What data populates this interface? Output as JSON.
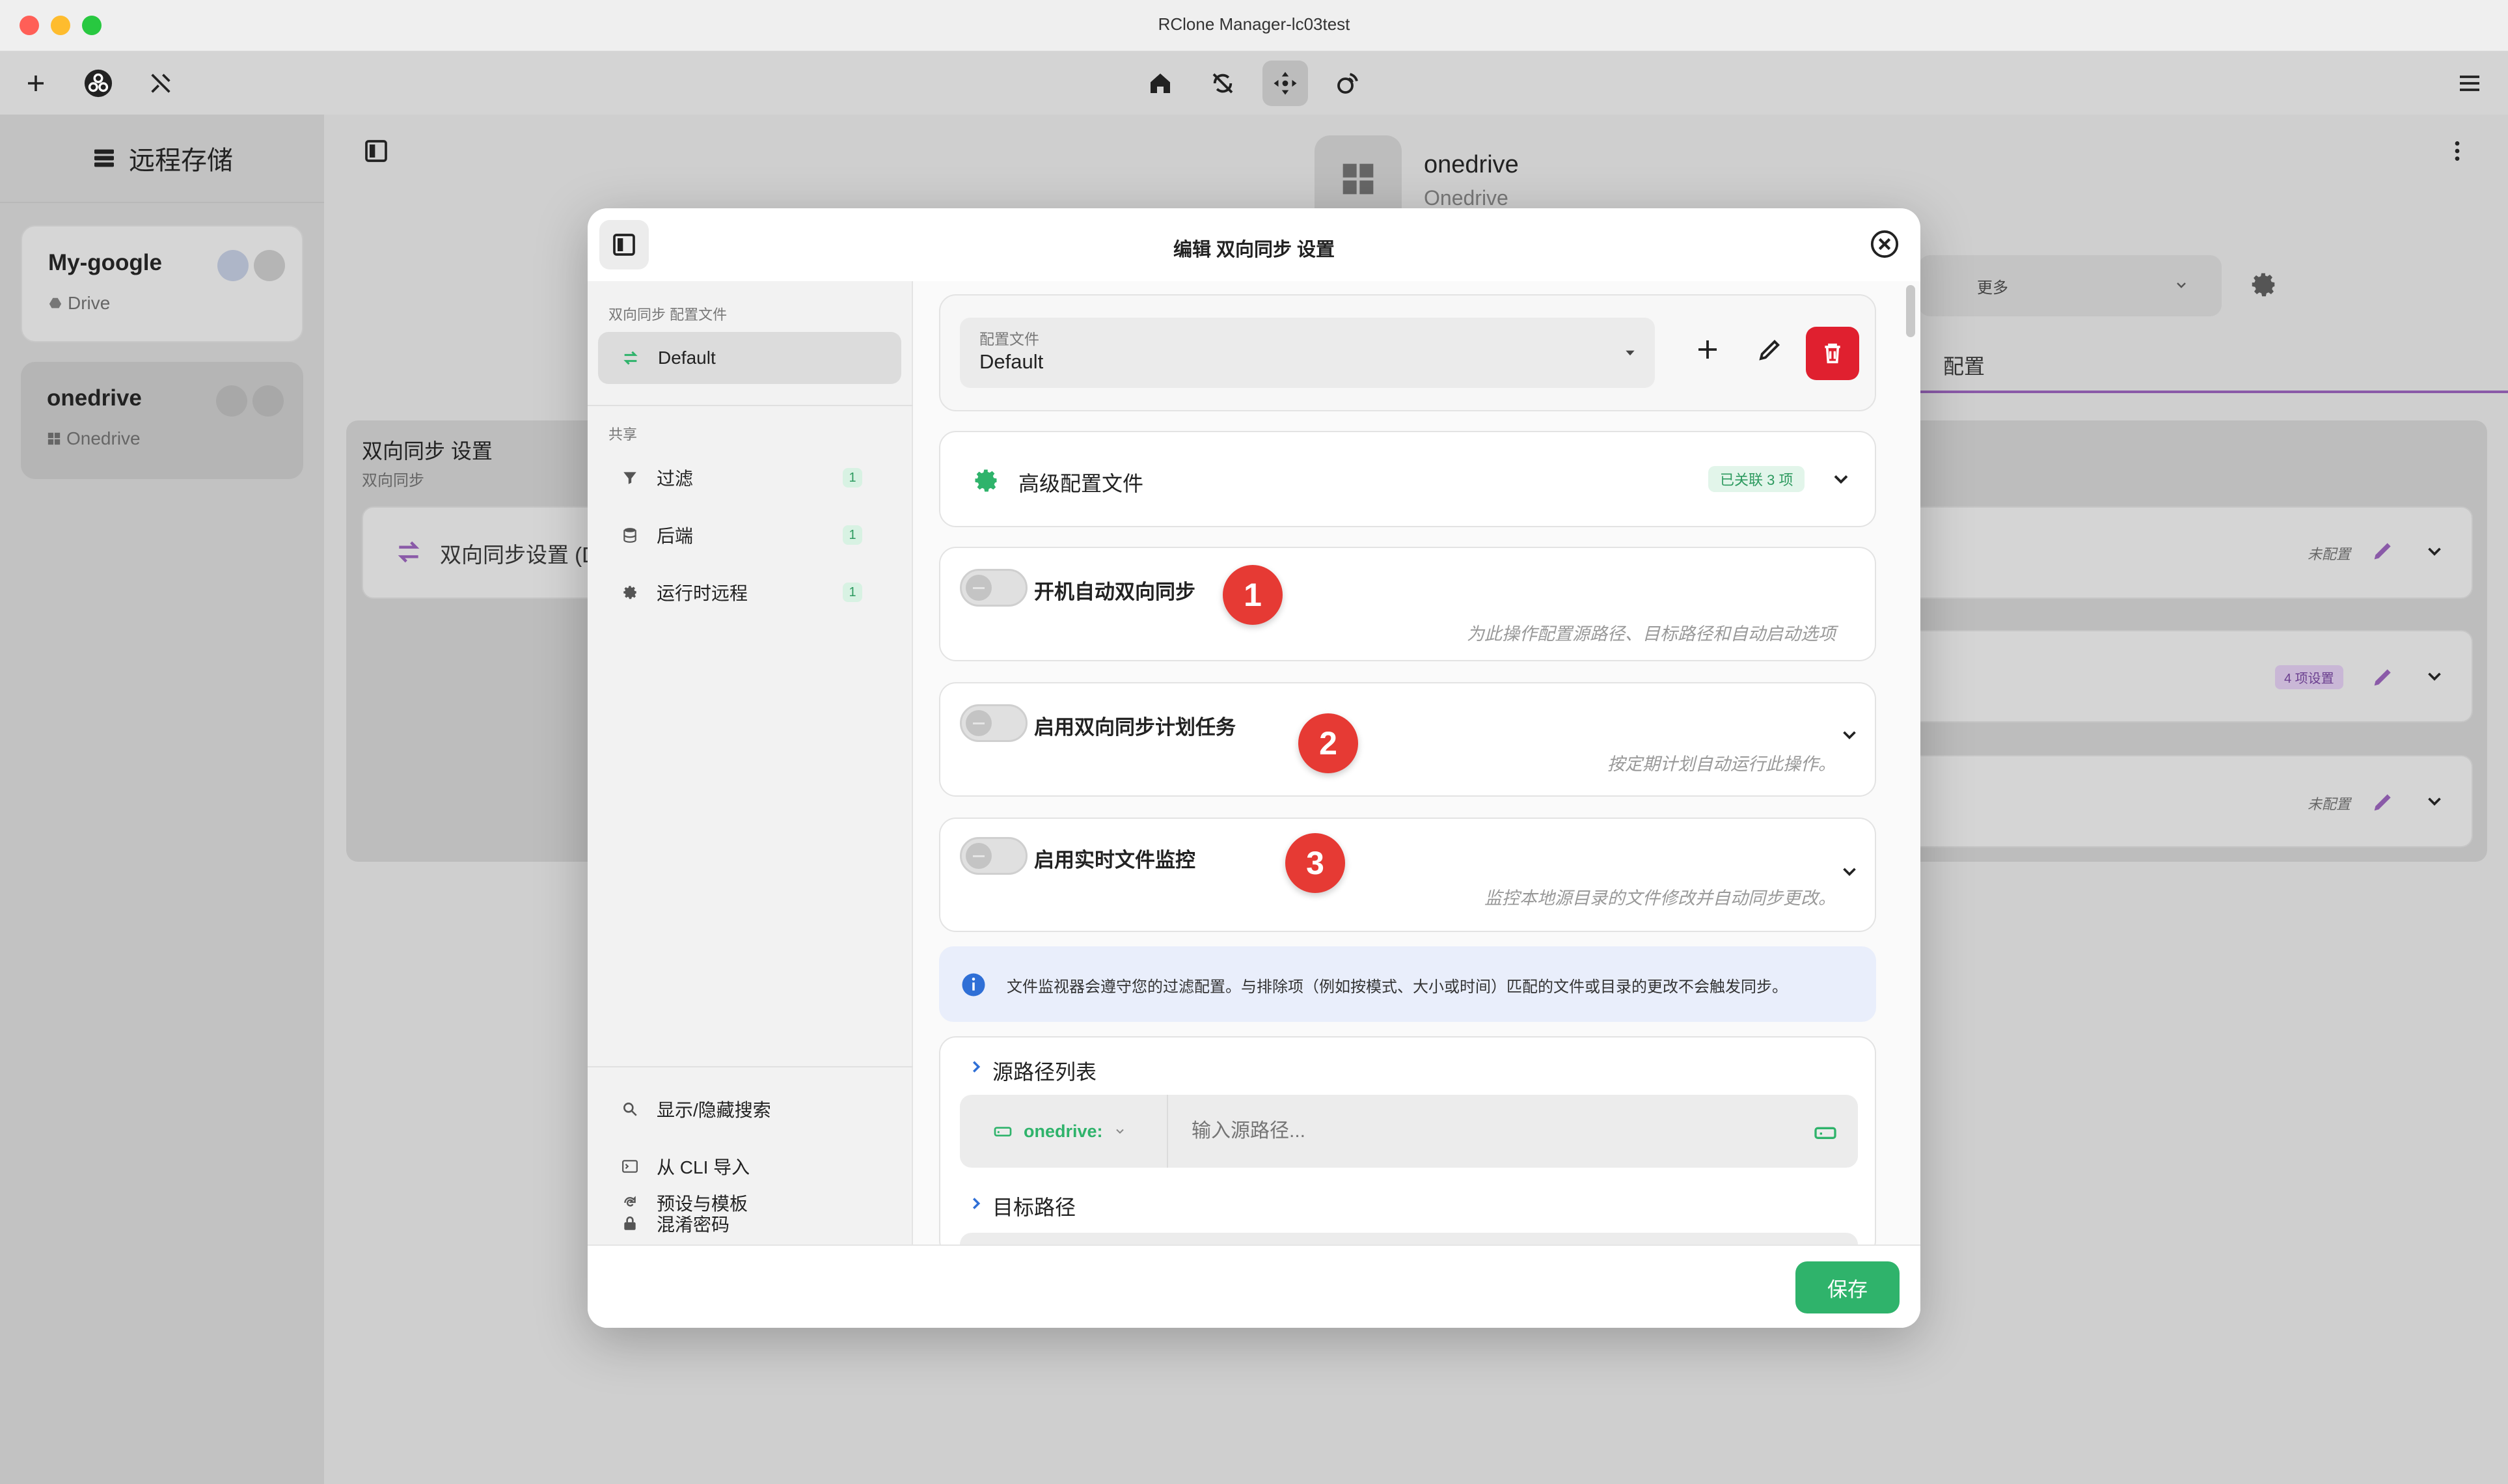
{
  "window": {
    "title": "RClone Manager-lc03test"
  },
  "sidebar": {
    "title": "远程存储",
    "remotes": [
      {
        "name": "My-google",
        "type": "Drive"
      },
      {
        "name": "onedrive",
        "type": "Onedrive"
      }
    ]
  },
  "background": {
    "remote_name": "onedrive",
    "remote_type": "Onedrive",
    "more_label": "更多",
    "tab_config": "配置",
    "section_title": "双向同步 设置",
    "section_subtitle": "双向同步",
    "row_label": "双向同步设置 (D",
    "row_status": [
      "未配置",
      "4 项设置",
      "未配置"
    ]
  },
  "modal": {
    "title": "编辑 双向同步 设置",
    "profiles_label": "双向同步 配置文件",
    "profile_item": "Default",
    "shared_label": "共享",
    "shared_items": [
      {
        "label": "过滤",
        "count": "1"
      },
      {
        "label": "后端",
        "count": "1"
      },
      {
        "label": "运行时远程",
        "count": "1"
      }
    ],
    "bottom_items": [
      "显示/隐藏搜索",
      "从 CLI 导入",
      "混淆密码",
      "预设与模板"
    ],
    "profile_field_label": "配置文件",
    "profile_field_value": "Default",
    "advanced_title": "高级配置文件",
    "advanced_badge": "已关联 3 项",
    "toggles": [
      {
        "title": "开机自动双向同步",
        "desc": "为此操作配置源路径、目标路径和自动启动选项",
        "step": "1"
      },
      {
        "title": "启用双向同步计划任务",
        "desc": "按定期计划自动运行此操作。",
        "step": "2"
      },
      {
        "title": "启用实时文件监控",
        "desc": "监控本地源目录的文件修改并自动同步更改。",
        "step": "3"
      }
    ],
    "info_text": "文件监视器会遵守您的过滤配置。与排除项（例如按模式、大小或时间）匹配的文件或目录的更改不会触发同步。",
    "source_section": "源路径列表",
    "source_remote": "onedrive:",
    "source_placeholder": "输入源路径...",
    "dest_section": "目标路径",
    "save_label": "保存"
  },
  "colors": {
    "accent": "#2fb36b",
    "danger": "#e0202f",
    "step_badge": "#e63a34",
    "info_bg": "#e9eefb"
  }
}
